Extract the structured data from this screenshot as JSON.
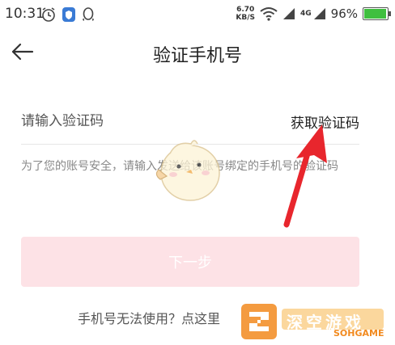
{
  "status": {
    "time": "10:31",
    "speed_value": "6.70",
    "speed_unit": "KB/S",
    "signal_label": "4G",
    "battery": "96%"
  },
  "header": {
    "title": "验证手机号"
  },
  "form": {
    "code_placeholder": "请输入验证码",
    "get_code_label": "获取验证码",
    "hint": "为了您的账号安全，请输入发送给该账号绑定的手机号的验证码"
  },
  "actions": {
    "next_label": "下一步",
    "phone_unusable": "手机号无法使用？点这里"
  },
  "colors": {
    "next_button_bg": "#fde2e6",
    "arrow": "#e8262d",
    "battery_fill": "#3fbf3f"
  },
  "watermark": {
    "text": "深空游戏",
    "sub": "SOHGAME"
  }
}
